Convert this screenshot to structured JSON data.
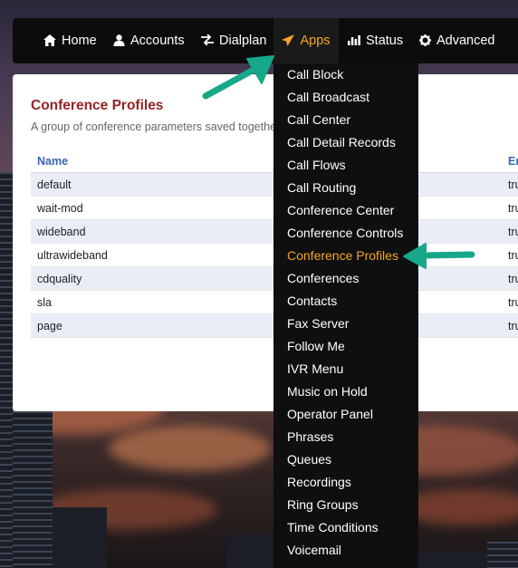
{
  "navbar": {
    "items": [
      {
        "label": "Home",
        "icon": "home-icon"
      },
      {
        "label": "Accounts",
        "icon": "user-icon"
      },
      {
        "label": "Dialplan",
        "icon": "transfer-icon"
      },
      {
        "label": "Apps",
        "icon": "send-icon",
        "active": true
      },
      {
        "label": "Status",
        "icon": "stats-icon"
      },
      {
        "label": "Advanced",
        "icon": "gear-icon"
      }
    ]
  },
  "page": {
    "title": "Conference Profiles",
    "description": "A group of conference parameters saved together as a profile."
  },
  "table": {
    "columns": [
      "Name",
      "En"
    ],
    "rows": [
      {
        "name": "default",
        "enabled": "tru"
      },
      {
        "name": "wait-mod",
        "enabled": "tru"
      },
      {
        "name": "wideband",
        "enabled": "tru"
      },
      {
        "name": "ultrawideband",
        "enabled": "tru"
      },
      {
        "name": "cdquality",
        "enabled": "tru"
      },
      {
        "name": "sla",
        "enabled": "tru"
      },
      {
        "name": "page",
        "enabled": "tru"
      }
    ]
  },
  "apps_menu": {
    "items": [
      "Call Block",
      "Call Broadcast",
      "Call Center",
      "Call Detail Records",
      "Call Flows",
      "Call Routing",
      "Conference Center",
      "Conference Controls",
      "Conference Profiles",
      "Conferences",
      "Contacts",
      "Fax Server",
      "Follow Me",
      "IVR Menu",
      "Music on Hold",
      "Operator Panel",
      "Phrases",
      "Queues",
      "Recordings",
      "Ring Groups",
      "Time Conditions",
      "Voicemail"
    ],
    "active": "Conference Profiles"
  },
  "colors": {
    "accent": "#f5a623",
    "title": "#952424",
    "link": "#3a66b0",
    "arrow": "#17a88a"
  }
}
